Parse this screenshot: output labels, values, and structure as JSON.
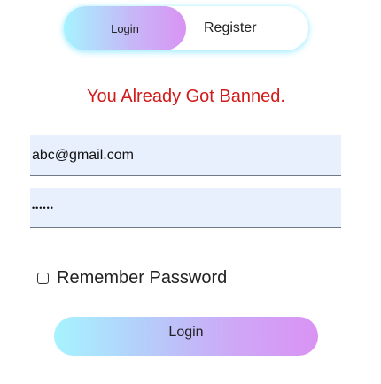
{
  "toggle": {
    "login_label": "Login",
    "register_label": "Register",
    "active": "Login"
  },
  "error_message": "You Already Got Banned.",
  "form": {
    "email_value": "abc@gmail.com",
    "password_value": "••••••",
    "remember_label": "Remember Password",
    "remember_checked": false,
    "submit_label": "Login"
  },
  "colors": {
    "error": "#d11a1a",
    "input_bg": "#e8f0fe",
    "gradient_start": "#a6f3ff",
    "gradient_end": "#d993f3"
  }
}
